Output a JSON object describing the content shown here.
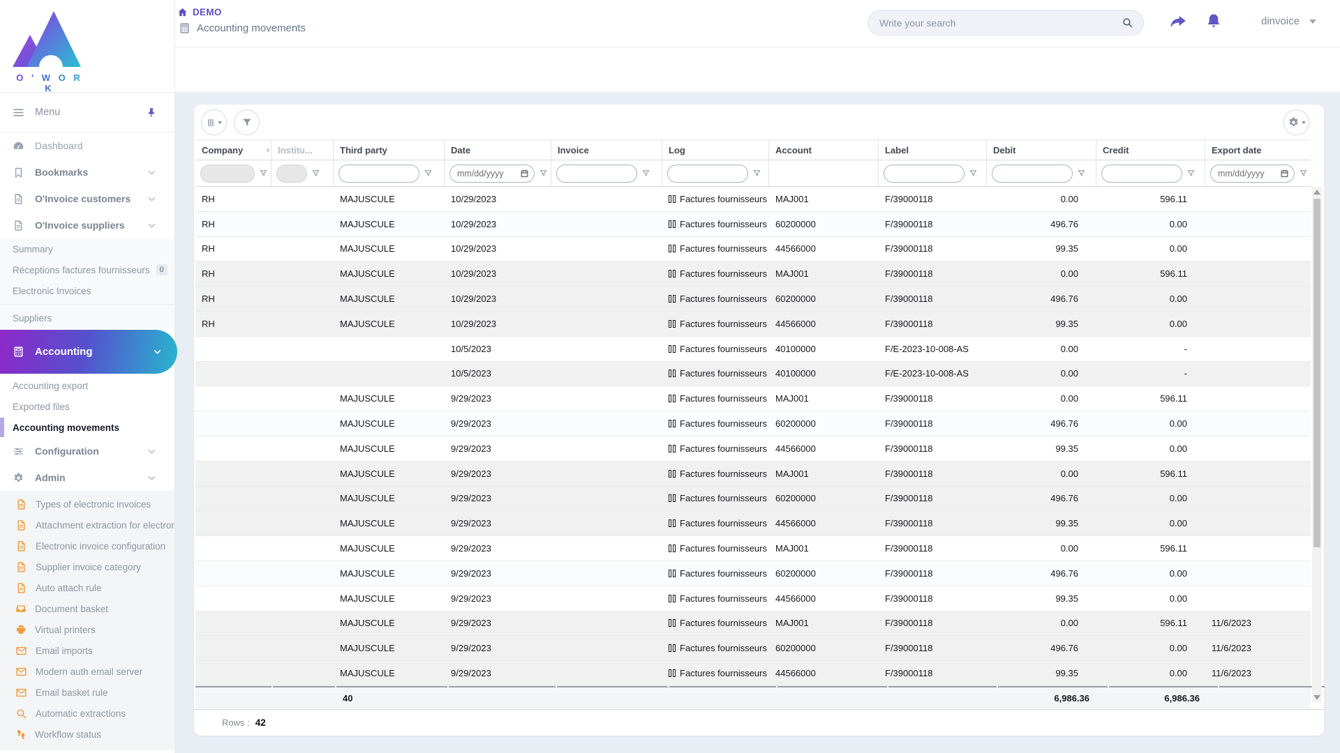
{
  "brand": {
    "name": "O ' W O R K"
  },
  "topbar": {
    "breadcrumb": {
      "home": "DEMO",
      "page": "Accounting movements"
    },
    "search": {
      "placeholder": "Write your search"
    },
    "user": {
      "name": "dinvoice"
    }
  },
  "sidebar": {
    "menu_label": "Menu",
    "items": [
      {
        "label": "Dashboard",
        "icon": "gauge",
        "type": "top"
      },
      {
        "label": "Bookmarks",
        "icon": "bookmark",
        "type": "top",
        "bold": true,
        "chevron": true
      },
      {
        "label": "O'Invoice customers",
        "icon": "file",
        "type": "top",
        "bold": true,
        "chevron": true
      },
      {
        "label": "O'Invoice suppliers",
        "icon": "file",
        "type": "top",
        "bold": true,
        "chevron": true
      },
      {
        "label": "Summary",
        "type": "sub",
        "block": "suppliers"
      },
      {
        "label": "Réceptions factures fournisseurs",
        "type": "sub",
        "block": "suppliers",
        "badge": "0"
      },
      {
        "label": "Electronic Invoices",
        "type": "sub",
        "block": "suppliers",
        "divider_after": true
      },
      {
        "label": "Suppliers",
        "type": "sub",
        "block": "suppliers"
      },
      {
        "label": "Accounting",
        "icon": "calculator",
        "type": "gradient",
        "chevron": true
      },
      {
        "label": "Accounting export",
        "type": "sub",
        "block": "accounting"
      },
      {
        "label": "Exported files",
        "type": "sub",
        "block": "accounting"
      },
      {
        "label": "Accounting movements",
        "type": "sub",
        "block": "accounting",
        "active": true
      },
      {
        "label": "Configuration",
        "icon": "sliders",
        "type": "top",
        "bold": true,
        "chevron": true
      },
      {
        "label": "Admin",
        "icon": "gear",
        "type": "top",
        "bold": true,
        "chevron": true
      },
      {
        "label": "Types of electronic invoices",
        "icon": "file",
        "type": "admin"
      },
      {
        "label": "Attachment extraction for electron",
        "icon": "file",
        "type": "admin"
      },
      {
        "label": "Electronic invoice configuration",
        "icon": "file",
        "type": "admin"
      },
      {
        "label": "Supplier invoice category",
        "icon": "file",
        "type": "admin"
      },
      {
        "label": "Auto attach rule",
        "icon": "file",
        "type": "admin"
      },
      {
        "label": "Document basket",
        "icon": "inbox",
        "type": "admin"
      },
      {
        "label": "Virtual printers",
        "icon": "printer",
        "type": "admin"
      },
      {
        "label": "Email imports",
        "icon": "envelope",
        "type": "admin"
      },
      {
        "label": "Modern auth email server",
        "icon": "envelope",
        "type": "admin"
      },
      {
        "label": "Email basket rule",
        "icon": "envelope",
        "type": "admin"
      },
      {
        "label": "Automatic extractions",
        "icon": "magnifier",
        "type": "admin"
      },
      {
        "label": "Workflow status",
        "icon": "footprints",
        "type": "admin"
      }
    ]
  },
  "table": {
    "columns": [
      {
        "label": "Company",
        "filter": "disabled",
        "expander": true
      },
      {
        "label": "Institu...",
        "filter": "disabled-small",
        "muted": true
      },
      {
        "label": "Third party",
        "filter": "text"
      },
      {
        "label": "Date",
        "filter": "date"
      },
      {
        "label": "Invoice",
        "filter": "text"
      },
      {
        "label": "Log",
        "filter": "text"
      },
      {
        "label": "Account",
        "filter": "none"
      },
      {
        "label": "Label",
        "filter": "text"
      },
      {
        "label": "Debit",
        "filter": "text"
      },
      {
        "label": "Credit",
        "filter": "text"
      },
      {
        "label": "Export date",
        "filter": "date"
      }
    ],
    "date_placeholder": "mm/dd/yyyy",
    "log_text": "Factures fournisseurs",
    "rows": [
      {
        "company": "RH",
        "institution": "",
        "third_party": "MAJUSCULE",
        "date": "10/29/2023",
        "invoice": "",
        "log": "Factures fournisseurs",
        "account": "MAJ001",
        "label": "F/39000118",
        "debit": "0.00",
        "credit": "596.11",
        "export_date": "",
        "group": 0
      },
      {
        "company": "RH",
        "institution": "",
        "third_party": "MAJUSCULE",
        "date": "10/29/2023",
        "invoice": "",
        "log": "Factures fournisseurs",
        "account": "60200000",
        "label": "F/39000118",
        "debit": "496.76",
        "credit": "0.00",
        "export_date": "",
        "group": 0
      },
      {
        "company": "RH",
        "institution": "",
        "third_party": "MAJUSCULE",
        "date": "10/29/2023",
        "invoice": "",
        "log": "Factures fournisseurs",
        "account": "44566000",
        "label": "F/39000118",
        "debit": "99.35",
        "credit": "0.00",
        "export_date": "",
        "group": 0
      },
      {
        "company": "RH",
        "institution": "",
        "third_party": "MAJUSCULE",
        "date": "10/29/2023",
        "invoice": "",
        "log": "Factures fournisseurs",
        "account": "MAJ001",
        "label": "F/39000118",
        "debit": "0.00",
        "credit": "596.11",
        "export_date": "",
        "group": 1
      },
      {
        "company": "RH",
        "institution": "",
        "third_party": "MAJUSCULE",
        "date": "10/29/2023",
        "invoice": "",
        "log": "Factures fournisseurs",
        "account": "60200000",
        "label": "F/39000118",
        "debit": "496.76",
        "credit": "0.00",
        "export_date": "",
        "group": 1
      },
      {
        "company": "RH",
        "institution": "",
        "third_party": "MAJUSCULE",
        "date": "10/29/2023",
        "invoice": "",
        "log": "Factures fournisseurs",
        "account": "44566000",
        "label": "F/39000118",
        "debit": "99.35",
        "credit": "0.00",
        "export_date": "",
        "group": 1
      },
      {
        "company": "",
        "institution": "",
        "third_party": "",
        "date": "10/5/2023",
        "invoice": "",
        "log": "Factures fournisseurs",
        "account": "40100000",
        "label": "F/E-2023-10-008-AS",
        "debit": "0.00",
        "credit": "-",
        "export_date": "",
        "group": 2
      },
      {
        "company": "",
        "institution": "",
        "third_party": "",
        "date": "10/5/2023",
        "invoice": "",
        "log": "Factures fournisseurs",
        "account": "40100000",
        "label": "F/E-2023-10-008-AS",
        "debit": "0.00",
        "credit": "-",
        "export_date": "",
        "group": 3
      },
      {
        "company": "",
        "institution": "",
        "third_party": "MAJUSCULE",
        "date": "9/29/2023",
        "invoice": "",
        "log": "Factures fournisseurs",
        "account": "MAJ001",
        "label": "F/39000118",
        "debit": "0.00",
        "credit": "596.11",
        "export_date": "",
        "group": 4
      },
      {
        "company": "",
        "institution": "",
        "third_party": "MAJUSCULE",
        "date": "9/29/2023",
        "invoice": "",
        "log": "Factures fournisseurs",
        "account": "60200000",
        "label": "F/39000118",
        "debit": "496.76",
        "credit": "0.00",
        "export_date": "",
        "group": 4
      },
      {
        "company": "",
        "institution": "",
        "third_party": "MAJUSCULE",
        "date": "9/29/2023",
        "invoice": "",
        "log": "Factures fournisseurs",
        "account": "44566000",
        "label": "F/39000118",
        "debit": "99.35",
        "credit": "0.00",
        "export_date": "",
        "group": 4
      },
      {
        "company": "",
        "institution": "",
        "third_party": "MAJUSCULE",
        "date": "9/29/2023",
        "invoice": "",
        "log": "Factures fournisseurs",
        "account": "MAJ001",
        "label": "F/39000118",
        "debit": "0.00",
        "credit": "596.11",
        "export_date": "",
        "group": 5
      },
      {
        "company": "",
        "institution": "",
        "third_party": "MAJUSCULE",
        "date": "9/29/2023",
        "invoice": "",
        "log": "Factures fournisseurs",
        "account": "60200000",
        "label": "F/39000118",
        "debit": "496.76",
        "credit": "0.00",
        "export_date": "",
        "group": 5
      },
      {
        "company": "",
        "institution": "",
        "third_party": "MAJUSCULE",
        "date": "9/29/2023",
        "invoice": "",
        "log": "Factures fournisseurs",
        "account": "44566000",
        "label": "F/39000118",
        "debit": "99.35",
        "credit": "0.00",
        "export_date": "",
        "group": 5
      },
      {
        "company": "",
        "institution": "",
        "third_party": "MAJUSCULE",
        "date": "9/29/2023",
        "invoice": "",
        "log": "Factures fournisseurs",
        "account": "MAJ001",
        "label": "F/39000118",
        "debit": "0.00",
        "credit": "596.11",
        "export_date": "",
        "group": 6
      },
      {
        "company": "",
        "institution": "",
        "third_party": "MAJUSCULE",
        "date": "9/29/2023",
        "invoice": "",
        "log": "Factures fournisseurs",
        "account": "60200000",
        "label": "F/39000118",
        "debit": "496.76",
        "credit": "0.00",
        "export_date": "",
        "group": 6
      },
      {
        "company": "",
        "institution": "",
        "third_party": "MAJUSCULE",
        "date": "9/29/2023",
        "invoice": "",
        "log": "Factures fournisseurs",
        "account": "44566000",
        "label": "F/39000118",
        "debit": "99.35",
        "credit": "0.00",
        "export_date": "",
        "group": 6
      },
      {
        "company": "",
        "institution": "",
        "third_party": "MAJUSCULE",
        "date": "9/29/2023",
        "invoice": "",
        "log": "Factures fournisseurs",
        "account": "MAJ001",
        "label": "F/39000118",
        "debit": "0.00",
        "credit": "596.11",
        "export_date": "11/6/2023",
        "group": 7
      },
      {
        "company": "",
        "institution": "",
        "third_party": "MAJUSCULE",
        "date": "9/29/2023",
        "invoice": "",
        "log": "Factures fournisseurs",
        "account": "60200000",
        "label": "F/39000118",
        "debit": "496.76",
        "credit": "0.00",
        "export_date": "11/6/2023",
        "group": 7
      },
      {
        "company": "",
        "institution": "",
        "third_party": "MAJUSCULE",
        "date": "9/29/2023",
        "invoice": "",
        "log": "Factures fournisseurs",
        "account": "44566000",
        "label": "F/39000118",
        "debit": "99.35",
        "credit": "0.00",
        "export_date": "11/6/2023",
        "group": 7
      }
    ],
    "totals": {
      "third_party": "40",
      "debit": "6,986.36",
      "credit": "6,986.36"
    },
    "footer": {
      "rows_label": "Rows :",
      "rows_value": "42"
    }
  },
  "colors": {
    "accent": "#6156c8",
    "gradient_from": "#8d28c9",
    "gradient_to": "#27b6ce",
    "admin_icon": "#f09c3d"
  }
}
